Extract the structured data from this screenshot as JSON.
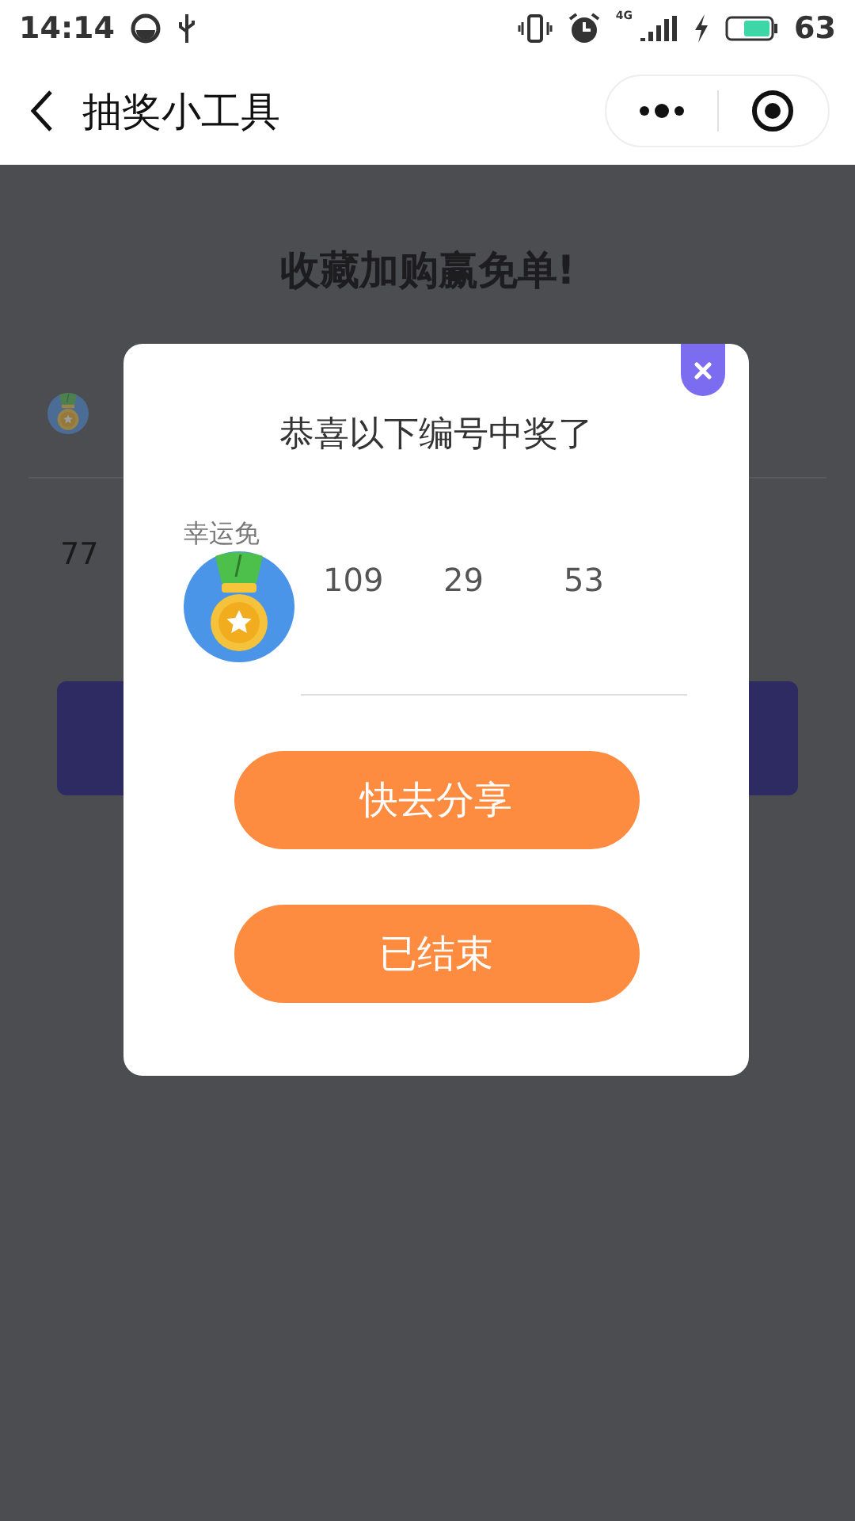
{
  "status_bar": {
    "time": "14:14",
    "network": "4G",
    "battery": "63"
  },
  "nav": {
    "title": "抽奖小工具"
  },
  "page": {
    "title": "收藏加购赢免单!",
    "entry_number": "77"
  },
  "dialog": {
    "title": "恭喜以下编号中奖了",
    "winner_label": "幸运免",
    "winning_numbers": [
      "109",
      "29",
      "53"
    ],
    "buttons": [
      {
        "label": "快去分享"
      },
      {
        "label": "已结束"
      }
    ]
  }
}
